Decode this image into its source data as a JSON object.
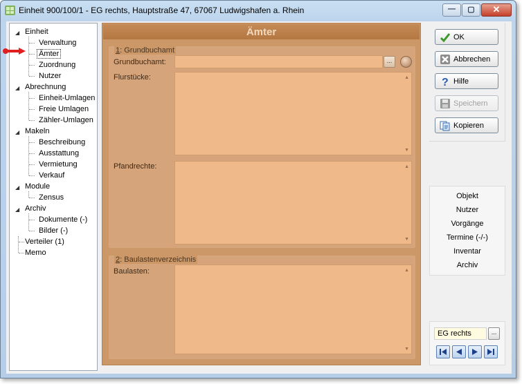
{
  "window": {
    "title": "Einheit 900/100/1 - EG rechts, Hauptstraße 47, 67067 Ludwigshafen a. Rhein",
    "minimize_glyph": "—",
    "maximize_glyph": "▢",
    "close_glyph": "✕"
  },
  "tree": {
    "items": [
      {
        "label": "Einheit",
        "level": 0,
        "expanded": true
      },
      {
        "label": "Verwaltung",
        "level": 1
      },
      {
        "label": "Ämter",
        "level": 1,
        "selected": true
      },
      {
        "label": "Zuordnung",
        "level": 1
      },
      {
        "label": "Nutzer",
        "level": 1
      },
      {
        "label": "Abrechnung",
        "level": 0,
        "expanded": true
      },
      {
        "label": "Einheit-Umlagen",
        "level": 1
      },
      {
        "label": "Freie Umlagen",
        "level": 1
      },
      {
        "label": "Zähler-Umlagen",
        "level": 1
      },
      {
        "label": "Makeln",
        "level": 0,
        "expanded": true
      },
      {
        "label": "Beschreibung",
        "level": 1
      },
      {
        "label": "Ausstattung",
        "level": 1
      },
      {
        "label": "Vermietung",
        "level": 1
      },
      {
        "label": "Verkauf",
        "level": 1
      },
      {
        "label": "Module",
        "level": 0,
        "expanded": true
      },
      {
        "label": "Zensus",
        "level": 1
      },
      {
        "label": "Archiv",
        "level": 0,
        "expanded": true
      },
      {
        "label": "Dokumente (-)",
        "level": 1
      },
      {
        "label": "Bilder (-)",
        "level": 1
      },
      {
        "label": "Verteiler (1)",
        "level": 0
      },
      {
        "label": "Memo",
        "level": 0
      }
    ]
  },
  "main": {
    "title": "Ämter",
    "group1": {
      "number": "1",
      "title": ": Grundbuchamt",
      "grundbuchamt_label": "Grundbuchamt:",
      "grundbuchamt_value": "",
      "flurstuecke_label": "Flurstücke:",
      "flurstuecke_value": "",
      "pfandrechte_label": "Pfandrechte:",
      "pfandrechte_value": "",
      "dots_label": "..."
    },
    "group2": {
      "number": "2",
      "title": ": Baulastenverzeichnis",
      "baulasten_label": "Baulasten:",
      "baulasten_value": ""
    }
  },
  "buttons": {
    "ok": "OK",
    "abbrechen": "Abbrechen",
    "hilfe": "Hilfe",
    "speichern": "Speichern",
    "kopieren": "Kopieren"
  },
  "links": [
    "Objekt",
    "Nutzer",
    "Vorgänge",
    "Termine (-/-)",
    "Inventar",
    "Archiv"
  ],
  "navigator": {
    "current": "EG rechts",
    "dots_label": "..."
  },
  "colors": {
    "panel": "#cc9867",
    "field": "#f0b98a",
    "header_text": "#f3d8bb",
    "marker": "#e02020"
  }
}
